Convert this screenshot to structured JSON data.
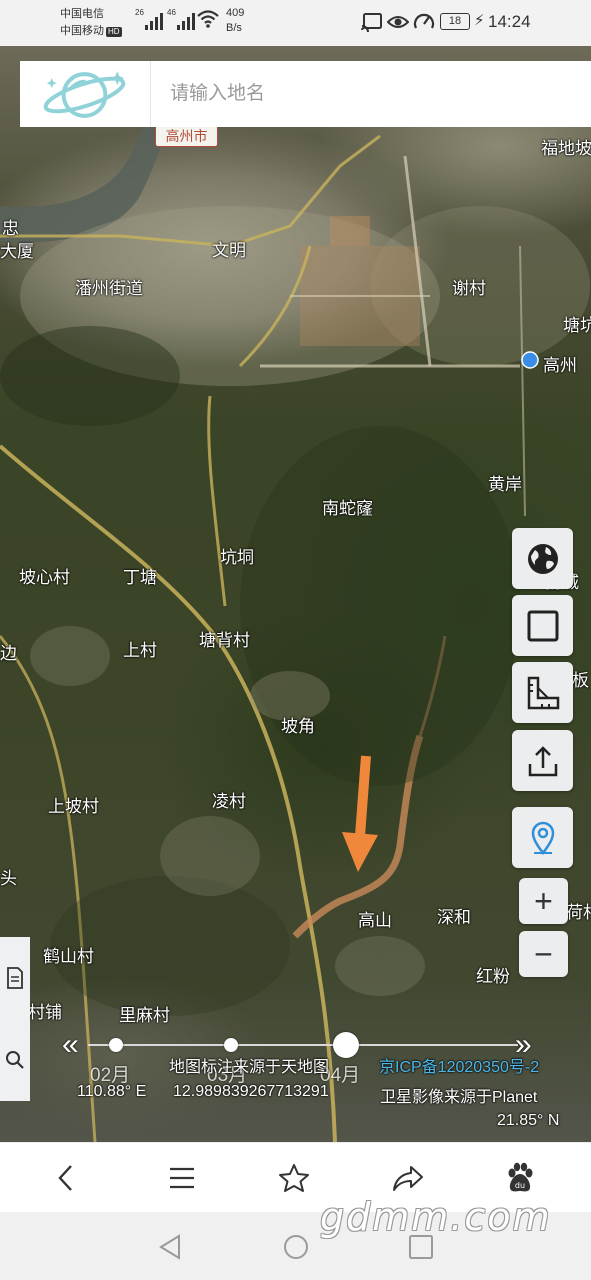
{
  "status_bar": {
    "carrier_1": "中国电信",
    "carrier_2": "中国移动",
    "hd_badge": "HD",
    "signal_1_tag": "26",
    "signal_2_tag": "46",
    "net_speed_value": "409",
    "net_speed_unit": "B/s",
    "battery": "18",
    "time": "14:24"
  },
  "search": {
    "placeholder": "请输入地名"
  },
  "map": {
    "city_shield": "高州市",
    "places": [
      "福地坡",
      "潘州街道",
      "文明",
      "谢村",
      "塘坑",
      "高州",
      "南蛇窿",
      "黄岸",
      "坑垌",
      "坡心村",
      "丁塘",
      "扬城",
      "塘背村",
      "上村",
      "边",
      "石板",
      "坡角",
      "上坡村",
      "凌村",
      "头",
      "高山",
      "深和",
      "荷村",
      "鹤山村",
      "红粉",
      "村铺",
      "里麻村",
      "大厦",
      "忠"
    ],
    "arrow_color": "#f0883c"
  },
  "tools": {
    "layers": "globe-icon",
    "draw": "square-icon",
    "measure": "ruler-icon",
    "share": "upload-icon",
    "locate": "location-pin-icon",
    "zoom_in": "+",
    "zoom_out": "−"
  },
  "timeline": {
    "labels": [
      "02月",
      "03月",
      "04月"
    ],
    "prev": "«",
    "next": "»"
  },
  "footer": {
    "annotation_source": "地图标注来源于天地图",
    "icp": "京ICP备12020350号-2",
    "longitude": "110.88° E",
    "center_value": "12.989839267713291",
    "imagery_source": "卫星影像来源于Planet",
    "latitude": "21.85° N"
  },
  "browser": {
    "back": "back-icon",
    "menu": "menu-icon",
    "favorite": "star-icon",
    "share": "share-icon",
    "baidu": "du"
  },
  "watermark": "gdmm.com"
}
